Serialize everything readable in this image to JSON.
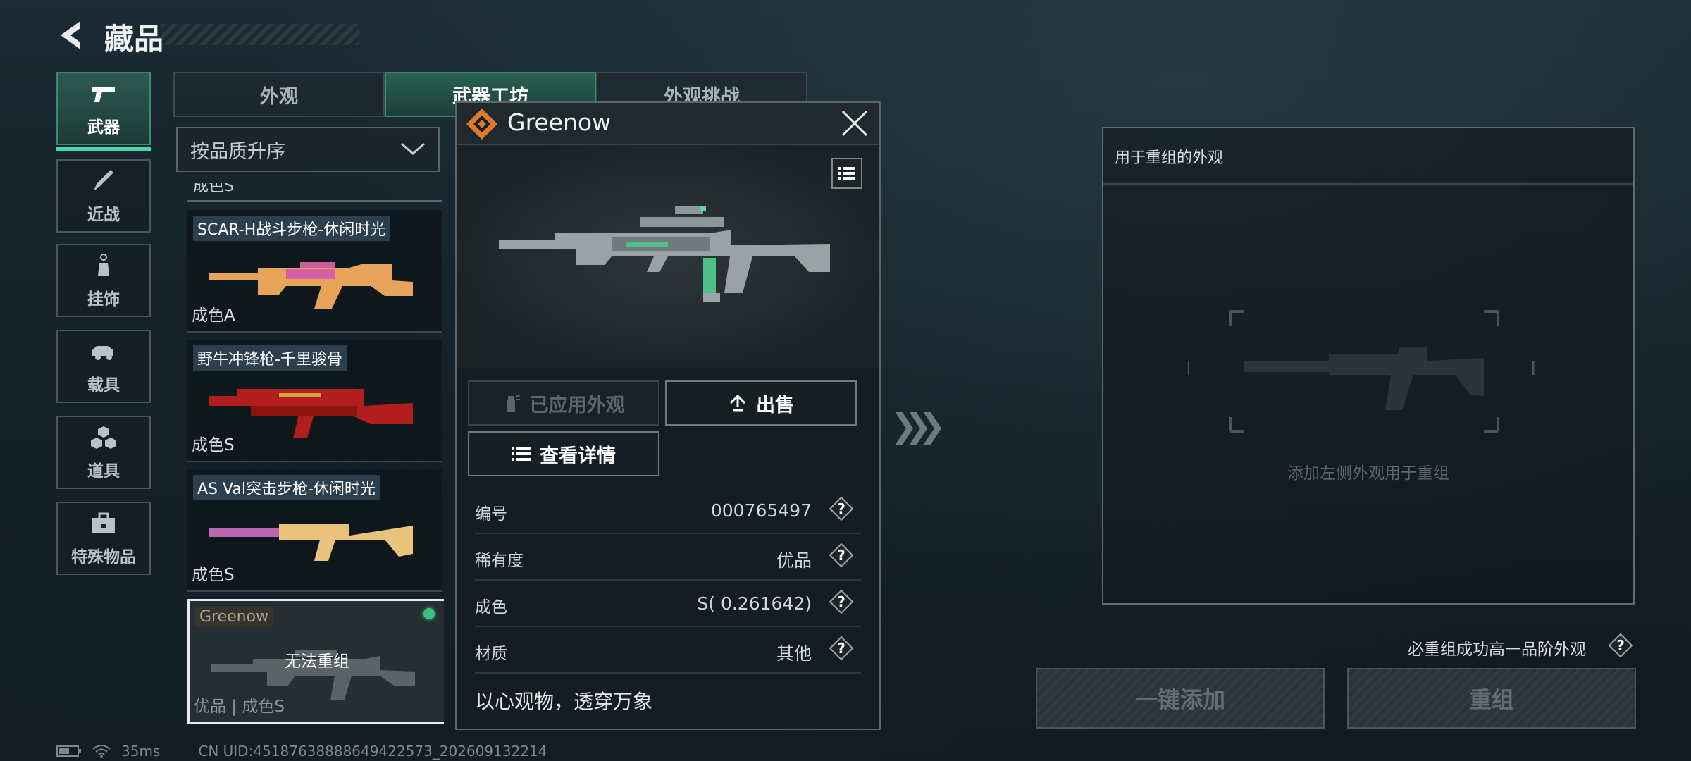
{
  "header": {
    "title": "藏品"
  },
  "nav": [
    {
      "label": "武器",
      "icon": "pistol-icon",
      "active": true
    },
    {
      "label": "近战",
      "icon": "knife-icon"
    },
    {
      "label": "挂饰",
      "icon": "charm-icon"
    },
    {
      "label": "载具",
      "icon": "car-icon"
    },
    {
      "label": "道具",
      "icon": "cubes-icon"
    },
    {
      "label": "特殊物品",
      "icon": "toolbox-icon"
    }
  ],
  "tabs": [
    {
      "label": "外观"
    },
    {
      "label": "武器工坊",
      "active": true
    },
    {
      "label": "外观挑战"
    }
  ],
  "sort": {
    "label": "按品质升序"
  },
  "list": {
    "partial_label": "成色S",
    "items": [
      {
        "name": "SCAR-H战斗步枪-休闲时光",
        "grade": "成色A"
      },
      {
        "name": "野牛冲锋枪-千里骏骨",
        "grade": "成色S"
      },
      {
        "name": "AS Val突击步枪-休闲时光",
        "grade": "成色S"
      },
      {
        "name": "Greenow",
        "grade": "优品 | 成色S",
        "overlay": "无法重组",
        "selected": true
      }
    ]
  },
  "popup": {
    "title": "Greenow",
    "applied_label": "已应用外观",
    "sell_label": "出售",
    "details_label": "查看详情",
    "rows": [
      {
        "key": "编号",
        "value": "000765497"
      },
      {
        "key": "稀有度",
        "value": "优品"
      },
      {
        "key": "成色",
        "value": "S( 0.261642)"
      },
      {
        "key": "材质",
        "value": "其他"
      }
    ],
    "quote": "以心观物，透穿万象"
  },
  "recombine": {
    "panel_title": "用于重组的外观",
    "hint": "添加左侧外观用于重组",
    "guarantee": "必重组成功高一品阶外观",
    "add_all_label": "一键添加",
    "recombine_label": "重组"
  },
  "status": {
    "ping": "35ms",
    "uid": "CN UID:451876388886494225​73_202609132214"
  },
  "colors": {
    "accent": "#4fd4a4",
    "active_tab": "#2b6152",
    "orange_logo": "#e07a2e"
  }
}
